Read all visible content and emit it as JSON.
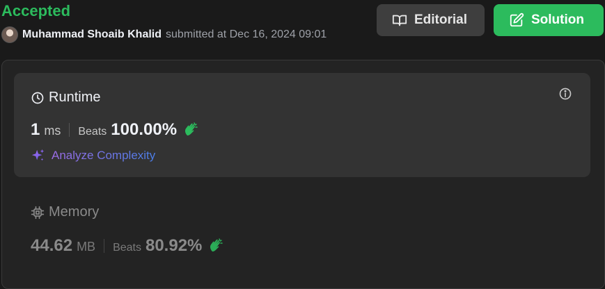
{
  "submission": {
    "status": "Accepted",
    "username": "Muhammad Shoaib Khalid",
    "submitted_text": "submitted at Dec 16, 2024 09:01"
  },
  "actions": {
    "editorial_label": "Editorial",
    "solution_label": "Solution"
  },
  "runtime": {
    "title": "Runtime",
    "value": "1",
    "unit": "ms",
    "beats_label": "Beats",
    "beats_value": "100.00%",
    "analyze_label": "Analyze Complexity"
  },
  "memory": {
    "title": "Memory",
    "value": "44.62",
    "unit": "MB",
    "beats_label": "Beats",
    "beats_value": "80.92%"
  },
  "colors": {
    "accepted": "#2cbb5d",
    "solution_button": "#2cbb5d",
    "editorial_button": "#3e3e3e",
    "background": "#1a1a1a",
    "card": "#333333"
  },
  "icons": {
    "editorial": "book-icon",
    "solution": "edit-icon",
    "runtime": "clock-icon",
    "memory": "chip-icon",
    "info": "info-icon",
    "analyze": "sparkle-icon",
    "beats": "clap-icon"
  }
}
